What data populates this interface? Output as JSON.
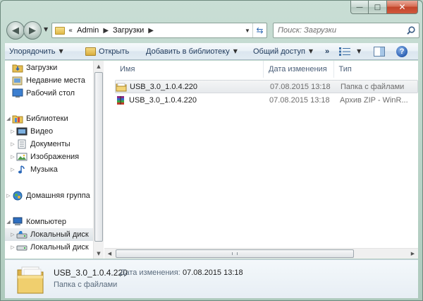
{
  "window": {
    "caption": {
      "minimize": "—",
      "maximize": "□",
      "close": "✕"
    }
  },
  "navbar": {
    "address_prefix": "«",
    "breadcrumb": [
      "Admin",
      "Загрузки"
    ],
    "search_placeholder": "Поиск: Загрузки"
  },
  "toolbar": {
    "organize": "Упорядочить",
    "open": "Открыть",
    "add_to_library": "Добавить в библиотеку",
    "share": "Общий доступ",
    "more": "»",
    "help": "?"
  },
  "sidebar": {
    "items": [
      {
        "label": "Загрузки",
        "icon": "downloads-folder-icon"
      },
      {
        "label": "Недавние места",
        "icon": "recent-places-icon"
      },
      {
        "label": "Рабочий стол",
        "icon": "desktop-icon"
      },
      {
        "label": "Библиотеки",
        "icon": "libraries-icon"
      },
      {
        "label": "Видео",
        "icon": "video-library-icon"
      },
      {
        "label": "Документы",
        "icon": "documents-library-icon"
      },
      {
        "label": "Изображения",
        "icon": "pictures-library-icon"
      },
      {
        "label": "Музыка",
        "icon": "music-library-icon"
      },
      {
        "label": "Домашняя группа",
        "icon": "homegroup-icon"
      },
      {
        "label": "Компьютер",
        "icon": "computer-icon"
      },
      {
        "label": "Локальный диск",
        "icon": "local-disk-icon"
      },
      {
        "label": "Локальный диск",
        "icon": "local-disk-icon"
      }
    ]
  },
  "columns": {
    "name": "Имя",
    "date": "Дата изменения",
    "type": "Тип"
  },
  "files": [
    {
      "name": "USB_3.0_1.0.4.220",
      "date": "07.08.2015 13:18",
      "type": "Папка с файлами",
      "icon": "folder-icon"
    },
    {
      "name": "USB_3.0_1.0.4.220",
      "date": "07.08.2015 13:18",
      "type": "Архив ZIP - WinR...",
      "icon": "winrar-archive-icon"
    }
  ],
  "details": {
    "name": "USB_3.0_1.0.4.220",
    "modified_label": "Дата изменения:",
    "modified_value": "07.08.2015 13:18",
    "type": "Папка с файлами"
  },
  "colors": {
    "frame": "#b8d2c6",
    "toolbar_text": "#1e395b",
    "folder_yellow": "#e0b846",
    "close_button": "#c2452b"
  }
}
